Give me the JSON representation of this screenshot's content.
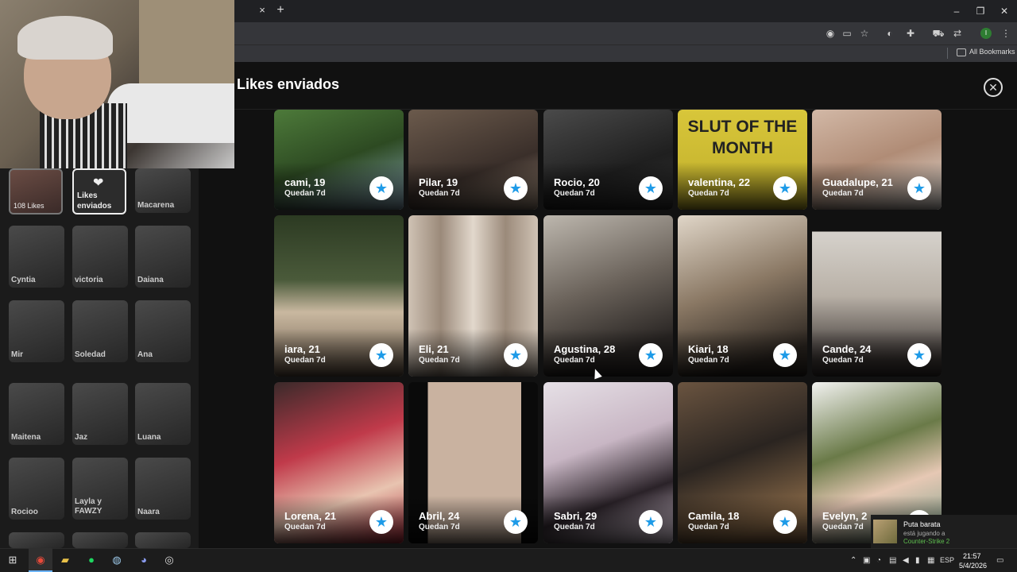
{
  "browser": {
    "tab_close": "×",
    "new_tab": "+",
    "window_buttons": [
      "–",
      "❐",
      "✕"
    ],
    "bookmarks_label": "All Bookmarks"
  },
  "modal": {
    "title": "Likes enviados",
    "close_glyph": "✕"
  },
  "sidebar": {
    "likes_tile": "108 Likes",
    "sent_tile": "Likes enviados",
    "sent_heart": "❤",
    "names": [
      "Macarena",
      "Cyntia",
      "victoria",
      "Daiana",
      "Mir",
      "Soledad",
      "Ana",
      "Maitena",
      "Jaz",
      "Luana",
      "Rocioo",
      "Layla y FAWZY",
      "Naara"
    ]
  },
  "cards": [
    {
      "name": "cami, 19",
      "sub": "Quedan 7d"
    },
    {
      "name": "Pilar, 19",
      "sub": "Quedan 7d"
    },
    {
      "name": "Rocio, 20",
      "sub": "Quedan 7d"
    },
    {
      "name": "valentina, 22",
      "sub": "Quedan 7d"
    },
    {
      "name": "Guadalupe, 21",
      "sub": "Quedan 7d"
    },
    {
      "name": "iara, 21",
      "sub": "Quedan 7d"
    },
    {
      "name": "Eli, 21",
      "sub": "Quedan 7d"
    },
    {
      "name": "Agustina, 28",
      "sub": "Quedan 7d"
    },
    {
      "name": "Kiari, 18",
      "sub": "Quedan 7d"
    },
    {
      "name": "Cande, 24",
      "sub": "Quedan 7d"
    },
    {
      "name": "Lorena, 21",
      "sub": "Quedan 7d"
    },
    {
      "name": "Abril, 24",
      "sub": "Quedan 7d"
    },
    {
      "name": "Sabri, 29",
      "sub": "Quedan 7d"
    },
    {
      "name": "Camila, 18",
      "sub": "Quedan 7d"
    },
    {
      "name": "Evelyn, 2",
      "sub": "Quedan 7d"
    }
  ],
  "card_star": "★",
  "photo_text": "SLUT OF THE MONTH",
  "notification": {
    "title": "Puta barata",
    "line1": "está jugando a",
    "line2": "Counter-Strike 2"
  },
  "taskbar": {
    "language": "ESP",
    "time": "21:57",
    "date": "5/4/2026"
  },
  "colors": {
    "accent_star": "#1e9be8",
    "steam_green": "#5fbf4f"
  },
  "icons": [
    "windows-icon",
    "chrome-icon",
    "folder-icon",
    "spotify-icon",
    "steam-icon",
    "discord-icon",
    "obs-icon",
    "star-icon",
    "close-icon",
    "heart-icon"
  ]
}
